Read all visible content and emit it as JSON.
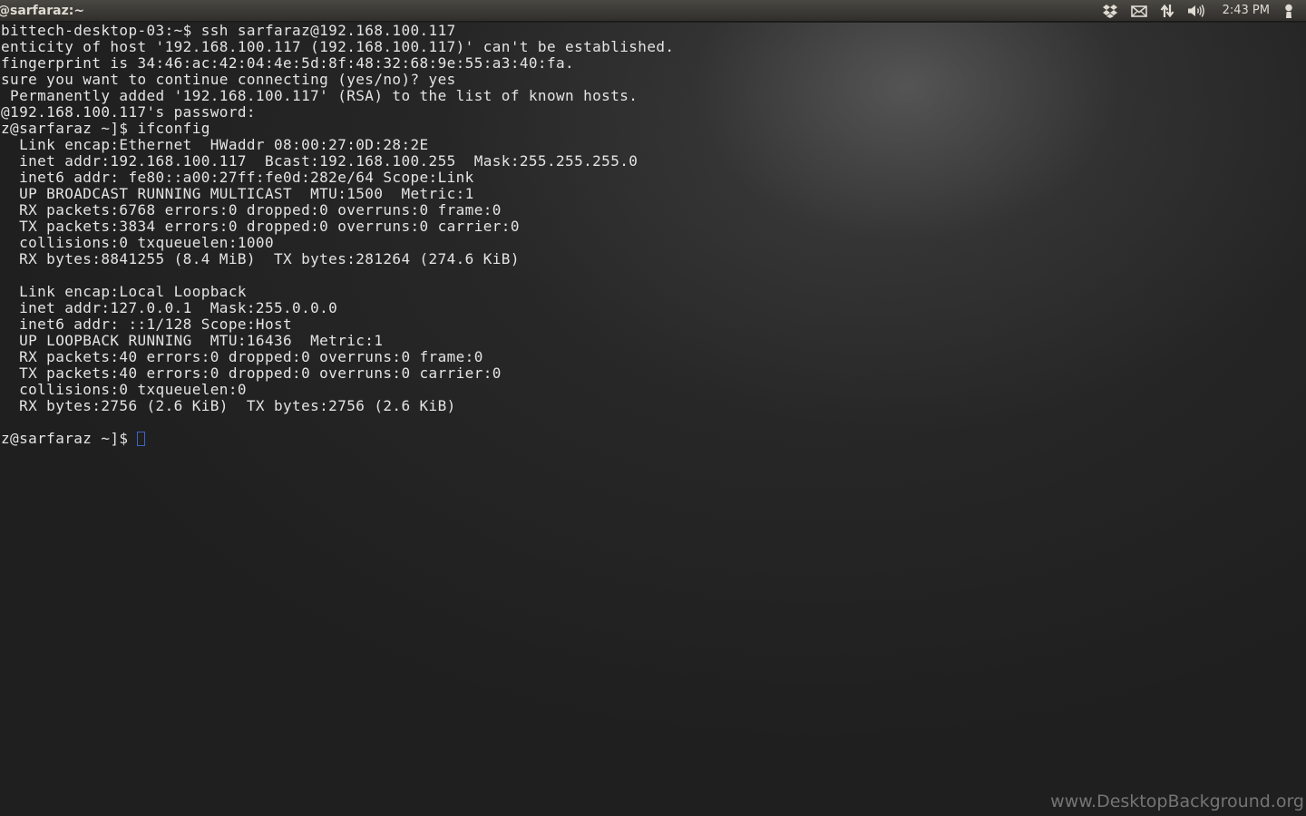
{
  "panel": {
    "window_title": "@sarfaraz:~",
    "clock": "2:43 PM",
    "indicators": [
      "dropbox-icon",
      "mail-icon",
      "network-icon",
      "sound-icon",
      "user-icon"
    ],
    "text_color": "#dfdbd2"
  },
  "terminal": {
    "lines": [
      "bittech-desktop-03:~$ ssh sarfaraz@192.168.100.117",
      "enticity of host '192.168.100.117 (192.168.100.117)' can't be established.",
      "fingerprint is 34:46:ac:42:04:4e:5d:8f:48:32:68:9e:55:a3:40:fa.",
      "sure you want to continue connecting (yes/no)? yes",
      " Permanently added '192.168.100.117' (RSA) to the list of known hosts.",
      "@192.168.100.117's password:",
      "z@sarfaraz ~]$ ifconfig",
      "  Link encap:Ethernet  HWaddr 08:00:27:0D:28:2E",
      "  inet addr:192.168.100.117  Bcast:192.168.100.255  Mask:255.255.255.0",
      "  inet6 addr: fe80::a00:27ff:fe0d:282e/64 Scope:Link",
      "  UP BROADCAST RUNNING MULTICAST  MTU:1500  Metric:1",
      "  RX packets:6768 errors:0 dropped:0 overruns:0 frame:0",
      "  TX packets:3834 errors:0 dropped:0 overruns:0 carrier:0",
      "  collisions:0 txqueuelen:1000",
      "  RX bytes:8841255 (8.4 MiB)  TX bytes:281264 (274.6 KiB)",
      "",
      "  Link encap:Local Loopback",
      "  inet addr:127.0.0.1  Mask:255.0.0.0",
      "  inet6 addr: ::1/128 Scope:Host",
      "  UP LOOPBACK RUNNING  MTU:16436  Metric:1",
      "  RX packets:40 errors:0 dropped:0 overruns:0 frame:0",
      "  TX packets:40 errors:0 dropped:0 overruns:0 carrier:0",
      "  collisions:0 txqueuelen:0",
      "  RX bytes:2756 (2.6 KiB)  TX bytes:2756 (2.6 KiB)",
      ""
    ],
    "prompt": "z@sarfaraz ~]$",
    "text_color": "#e4e4e4",
    "cursor_color": "#3a66c8"
  },
  "watermark": "www.DesktopBackground.org"
}
